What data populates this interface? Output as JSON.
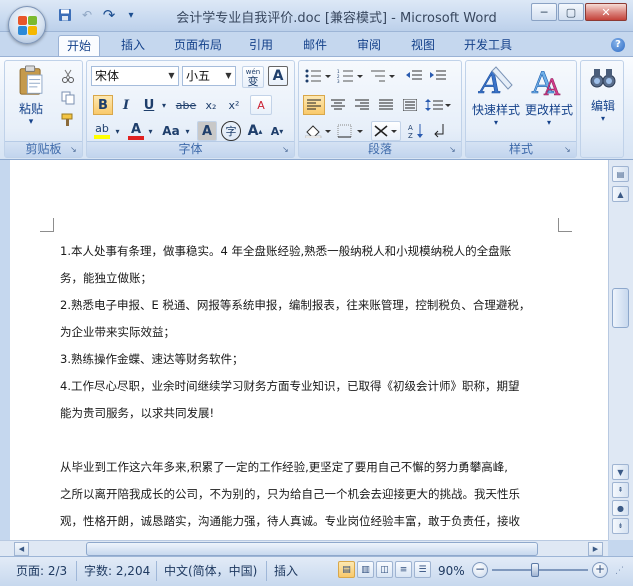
{
  "window": {
    "title": "会计学专业自我评价.doc [兼容模式] - Microsoft Word",
    "minimize_glyph": "─",
    "maximize_glyph": "▢",
    "close_glyph": "✕"
  },
  "quick_access": {
    "save_icon": "save-icon",
    "undo_glyph": "↶",
    "redo_glyph": "↷",
    "customize_glyph": "▾"
  },
  "tabs": [
    {
      "label": "开始",
      "active": true
    },
    {
      "label": "插入"
    },
    {
      "label": "页面布局"
    },
    {
      "label": "引用"
    },
    {
      "label": "邮件"
    },
    {
      "label": "审阅"
    },
    {
      "label": "视图"
    },
    {
      "label": "开发工具"
    }
  ],
  "ribbon": {
    "clipboard": {
      "label": "剪贴板",
      "paste_label": "粘贴",
      "paste_arrow": "▾"
    },
    "font": {
      "label": "字体",
      "font_name": "宋体",
      "font_size": "小五",
      "phonetic_label": "wén",
      "phonetic_char": "变",
      "border_char": "A",
      "bold": "B",
      "italic": "I",
      "underline": "U",
      "strike": "abe",
      "subscript": "x₂",
      "superscript": "x²",
      "clear_format": "A",
      "highlight": "ab",
      "font_color": "A",
      "change_case": "Aa",
      "shading_char": "A",
      "encircle_char": "字",
      "grow": "A",
      "shrink": "A"
    },
    "paragraph": {
      "label": "段落"
    },
    "styles": {
      "label": "样式",
      "quick_styles": "快速样式",
      "change_styles": "更改样式"
    },
    "editing": {
      "label": "编辑"
    }
  },
  "document": {
    "lines": [
      "1.本人处事有条理，做事稳实。4 年全盘账经验,熟悉一般纳税人和小规模纳税人的全盘账",
      "务，能独立做账；",
      "2.熟悉电子申报、E 税通、网报等系统申报，编制报表，往来账管理，控制税负、合理避税，",
      "为企业带来实际效益；",
      "3.熟练操作金蝶、速达等财务软件；",
      "4.工作尽心尽职，业余时间继续学习财务方面专业知识，已取得《初级会计师》职称，期望",
      "能为贵司服务，以求共同发展!",
      "",
      "从毕业到工作这六年多来,积累了一定的工作经验,更坚定了要用自己不懈的努力勇攀高峰,",
      "之所以离开陪我成长的公司，不为别的，只为给自己一个机会去迎接更大的挑战。我天性乐",
      "观，性格开朗，诚恳踏实，沟通能力强，待人真诚。专业岗位经验丰富，敢于负责任，接收"
    ]
  },
  "statusbar": {
    "page": "页面: 2/3",
    "words": "字数: 2,204",
    "language": "中文(简体，中国)",
    "mode": "插入",
    "zoom": "90%",
    "zoom_out": "−",
    "zoom_in": "+",
    "zoom_level": 0.9
  },
  "colors": {
    "highlight": "#ffff00",
    "font_color": "#e02020",
    "ribbon_text": "#15428b"
  }
}
